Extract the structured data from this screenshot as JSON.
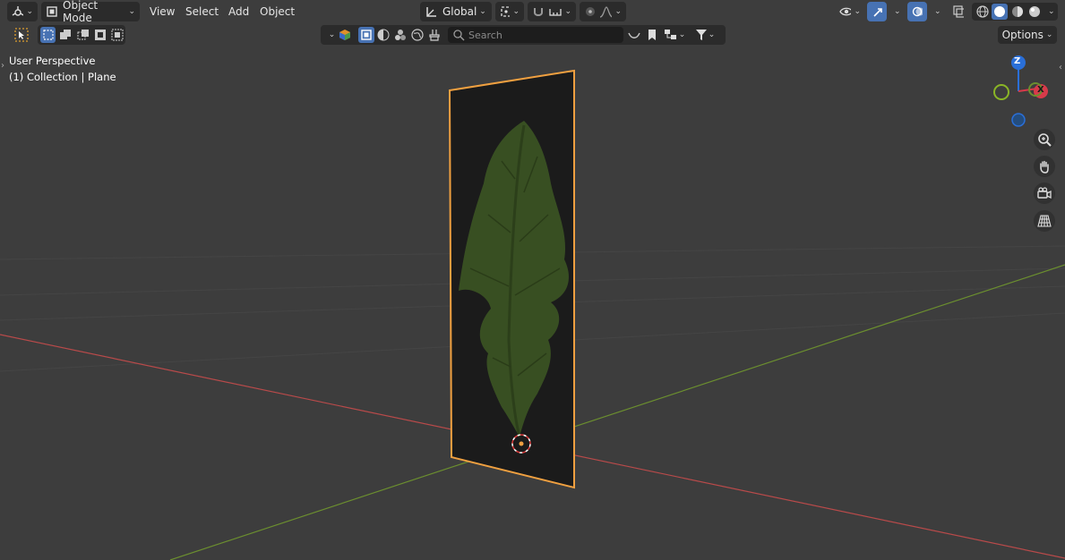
{
  "header": {
    "editor_type_icon": "viewport-icon",
    "mode_label": "Object Mode",
    "menus": [
      "View",
      "Select",
      "Add",
      "Object"
    ],
    "transform_orientation": "Global",
    "options_label": "Options"
  },
  "search": {
    "placeholder": "Search"
  },
  "viewport": {
    "perspective_label": "User Perspective",
    "collection_label": "(1) Collection | Plane"
  },
  "gizmo": {
    "z": "Z",
    "x": "X"
  },
  "colors": {
    "background": "#3d3d3d",
    "selection_outline": "#f0a040",
    "x_axis": "#b84a4a",
    "y_axis": "#6b8e2f",
    "gizmo_z": "#2a6fd8",
    "gizmo_x": "#d83a4a",
    "gizmo_y": "#8ab526"
  }
}
